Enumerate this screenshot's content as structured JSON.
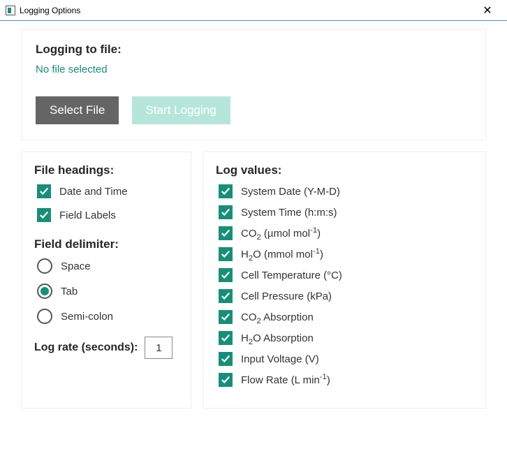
{
  "window": {
    "title": "Logging Options",
    "close": "✕"
  },
  "top": {
    "heading": "Logging to file:",
    "status": "No file selected",
    "select_file": "Select File",
    "start_logging": "Start Logging"
  },
  "left": {
    "file_headings": "File headings:",
    "opts": {
      "date_time": "Date and Time",
      "field_labels": "Field Labels"
    },
    "field_delimiter": "Field delimiter:",
    "delims": {
      "space": "Space",
      "tab": "Tab",
      "semi": "Semi-colon"
    },
    "log_rate_label": "Log rate (seconds):",
    "log_rate_value": "1"
  },
  "right": {
    "heading": "Log values:",
    "items": {
      "sys_date": "System Date (Y-M-D)",
      "sys_time": "System Time (h:m:s)",
      "cell_temp": "Cell Temperature (°C)",
      "cell_press": "Cell Pressure (kPa)",
      "input_v": "Input Voltage (V)"
    }
  }
}
